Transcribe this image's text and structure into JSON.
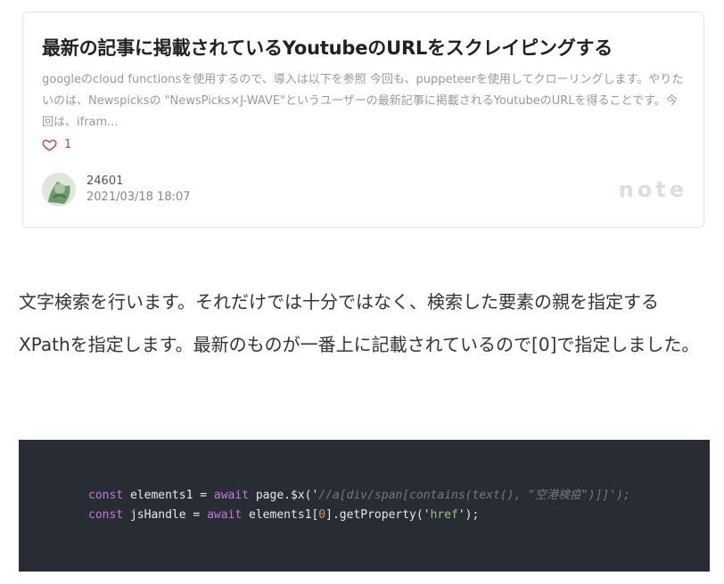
{
  "card": {
    "title": "最新の記事に掲載されているYoutubeのURLをスクレイピングする",
    "excerpt": "googleのcloud functionsを使用するので、導入は以下を参照 今回も、puppeteerを使用してクローリングします。やりたいのは、Newspicksの \"NewsPicks×J-WAVE\"というユーザーの最新記事に掲載されるYoutubeのURLを得ることです。今回は、ifram...",
    "likes": "1",
    "author_name": "24601",
    "date": "2021/03/18 18:07",
    "brand": "note",
    "accent_color": "#d33a4e"
  },
  "prose": {
    "text": "文字検索を行います。それだけでは十分ではなく、検索した要素の親を指定するXPathを指定します。最新のものが一番上に記載されているので[0]で指定しました。"
  },
  "code": {
    "line1": {
      "kw1": "const",
      "p1": " elements1 = ",
      "kw2": "await",
      "p2": " page.$x('",
      "com": "//a[div/span[contains(text(), \"空港検疫\")]]');",
      "p3": ""
    },
    "line2": {
      "kw1": "const",
      "p1": " jsHandle = ",
      "kw2": "await",
      "p2": " elements1[",
      "num": "0",
      "p3": "].getProperty('",
      "str": "href",
      "p4": "');"
    }
  }
}
